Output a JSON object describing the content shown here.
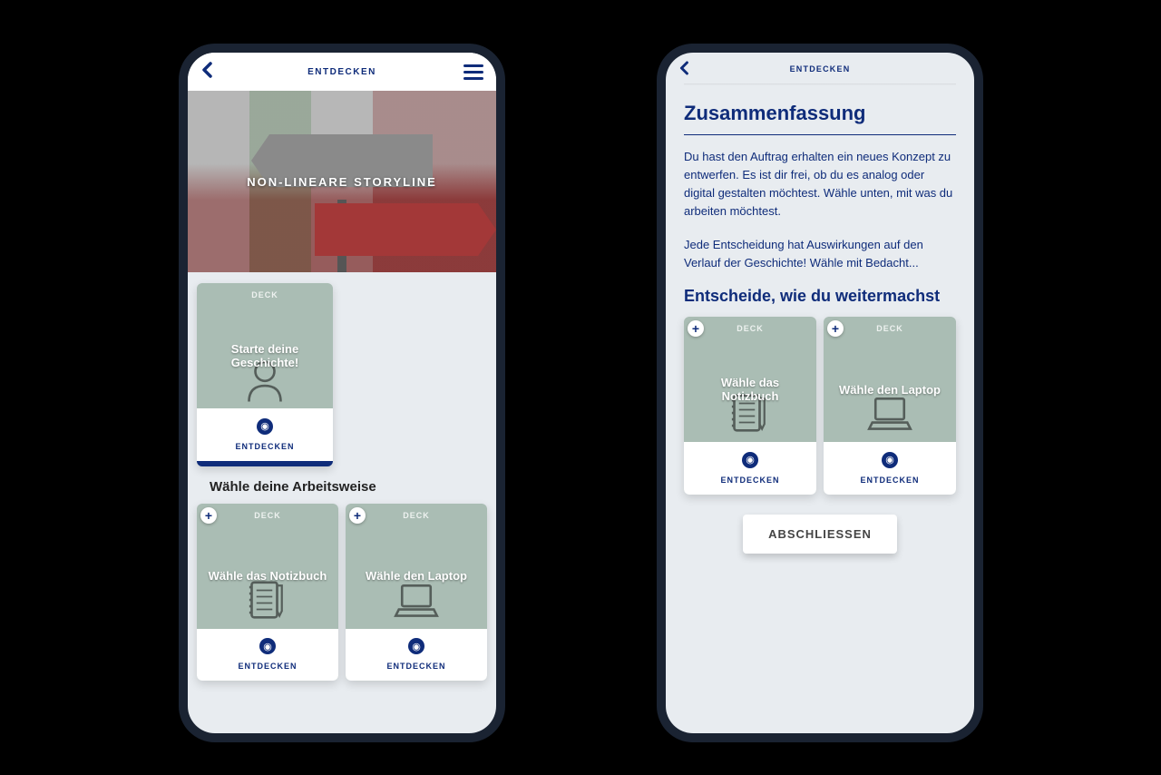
{
  "colors": {
    "primary": "#0f2c7a",
    "card": "#aabdb4",
    "bg": "#e8ecf0"
  },
  "left": {
    "header": {
      "title": "ENTDECKEN"
    },
    "hero": {
      "title": "NON-LINEARE STORYLINE"
    },
    "main_card": {
      "tag": "DECK",
      "title": "Starte deine Geschichte!",
      "action": "ENTDECKEN"
    },
    "section_title": "Wähle deine Arbeitsweise",
    "cards": [
      {
        "tag": "DECK",
        "title": "Wähle das Notizbuch",
        "action": "ENTDECKEN",
        "icon": "notebook"
      },
      {
        "tag": "DECK",
        "title": "Wähle den Laptop",
        "action": "ENTDECKEN",
        "icon": "laptop"
      }
    ]
  },
  "right": {
    "header": {
      "title": "ENTDECKEN"
    },
    "summary": {
      "heading": "Zusammenfassung",
      "p1": "Du hast den Auftrag erhalten ein neues Konzept zu entwerfen. Es ist dir frei, ob du es analog oder digital gestalten möchtest. Wähle unten, mit was du arbeiten möchtest.",
      "p2": "Jede Entscheidung hat Auswirkungen auf den Verlauf der Geschichte! Wähle mit Bedacht..."
    },
    "choose_heading": "Entscheide, wie du weitermachst",
    "cards": [
      {
        "tag": "DECK",
        "title": "Wähle das Notizbuch",
        "action": "ENTDECKEN",
        "icon": "notebook"
      },
      {
        "tag": "DECK",
        "title": "Wähle den Laptop",
        "action": "ENTDECKEN",
        "icon": "laptop"
      }
    ],
    "finish_button": "ABSCHLIESSEN"
  }
}
